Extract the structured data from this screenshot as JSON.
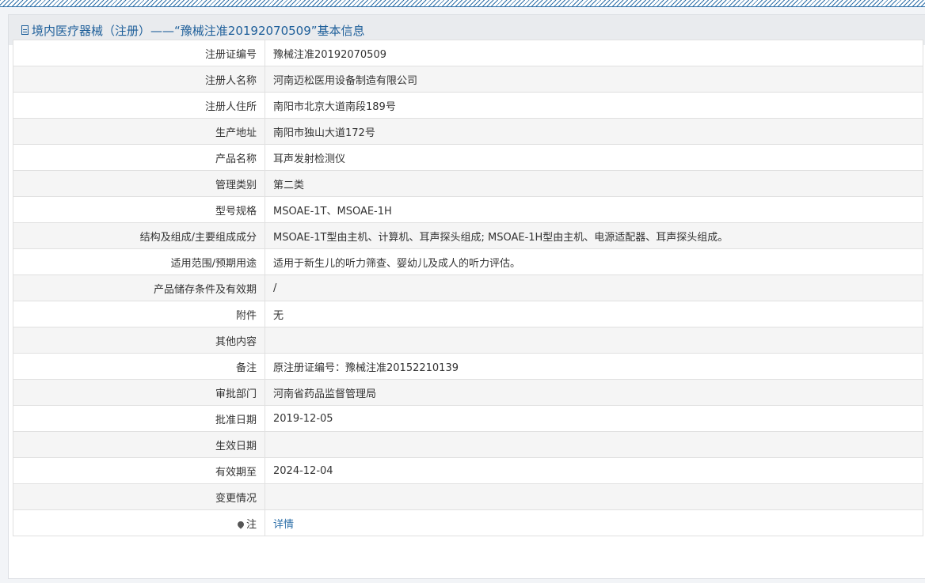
{
  "header": {
    "title": "境内医疗器械（注册）——“豫械注准20192070509”基本信息"
  },
  "rows": [
    {
      "label": "注册证编号",
      "value": "豫械注准20192070509"
    },
    {
      "label": "注册人名称",
      "value": "河南迈松医用设备制造有限公司"
    },
    {
      "label": "注册人住所",
      "value": "南阳市北京大道南段189号"
    },
    {
      "label": "生产地址",
      "value": "南阳市独山大道172号"
    },
    {
      "label": "产品名称",
      "value": "耳声发射检测仪"
    },
    {
      "label": "管理类别",
      "value": "第二类"
    },
    {
      "label": "型号规格",
      "value": "MSOAE-1T、MSOAE-1H"
    },
    {
      "label": "结构及组成/主要组成成分",
      "value": "MSOAE-1T型由主机、计算机、耳声探头组成; MSOAE-1H型由主机、电源适配器、耳声探头组成。"
    },
    {
      "label": "适用范围/预期用途",
      "value": "适用于新生儿的听力筛查、婴幼儿及成人的听力评估。"
    },
    {
      "label": "产品储存条件及有效期",
      "value": "/"
    },
    {
      "label": "附件",
      "value": "无"
    },
    {
      "label": "其他内容",
      "value": ""
    },
    {
      "label": "备注",
      "value": "原注册证编号：豫械注准20152210139"
    },
    {
      "label": "审批部门",
      "value": "河南省药品监督管理局"
    },
    {
      "label": "批准日期",
      "value": "2019-12-05"
    },
    {
      "label": "生效日期",
      "value": ""
    },
    {
      "label": "有效期至",
      "value": "2024-12-04"
    },
    {
      "label": "变更情况",
      "value": ""
    }
  ],
  "note_row": {
    "label": "注",
    "link": "详情",
    "icon": "pin-icon"
  }
}
